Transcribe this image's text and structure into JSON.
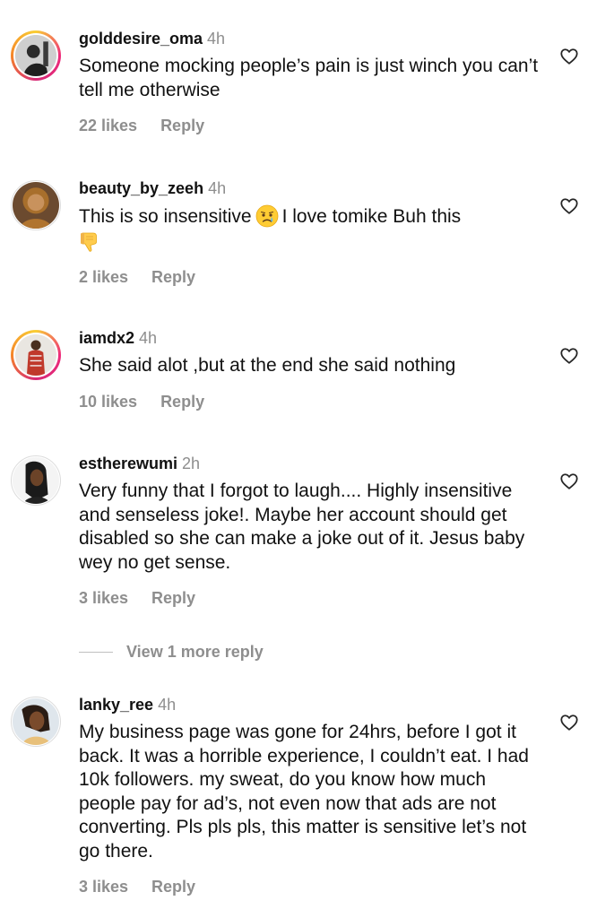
{
  "comments": [
    {
      "username": "golddesire_oma",
      "time": "4h",
      "text": "Someone mocking people’s pain is just winch you can’t tell me otherwise",
      "likes": "22 likes",
      "reply": "Reply"
    },
    {
      "username": "beauty_by_zeeh",
      "time": "4h",
      "text_before_emoji": "This is so insensitive",
      "text_after_emoji": "I love tomike Buh this",
      "emoji_1": "crying-face",
      "emoji_2": "thumbs-down",
      "likes": "2 likes",
      "reply": "Reply"
    },
    {
      "username": "iamdx2",
      "time": "4h",
      "text": "She said alot ,but at the end she said nothing",
      "likes": "10 likes",
      "reply": "Reply"
    },
    {
      "username": "estherewumi",
      "time": "2h",
      "text": "Very funny that I forgot to laugh.... Highly insensitive and senseless joke!. Maybe her account should get disabled so she can make a joke out of it. Jesus baby wey no get sense.",
      "likes": "3 likes",
      "reply": "Reply"
    },
    {
      "username": "lanky_ree",
      "time": "4h",
      "text": "My business page was gone for 24hrs, before I got it back.  It was a horrible experience, I couldn’t eat.  I had 10k followers. my sweat, do you know how much people pay for ad’s, not even now that ads are not converting. Pls pls pls, this matter is sensitive let’s not go there.",
      "likes": "3 likes",
      "reply": "Reply"
    }
  ],
  "view_more_replies": "View 1 more reply",
  "icons": {
    "like": "heart-outline-icon",
    "story_ring_colors": [
      "#f9ce34",
      "#ee2a7b",
      "#d62976",
      "#f58529"
    ]
  },
  "colors": {
    "text": "#111111",
    "muted": "#8e8e8e",
    "background": "#ffffff"
  }
}
